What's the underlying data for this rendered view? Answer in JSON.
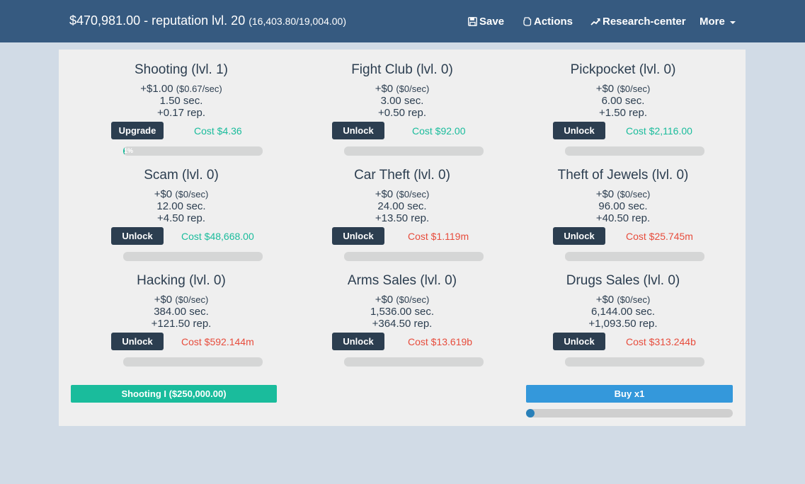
{
  "header": {
    "money": "$470,981.00",
    "reputation": "- reputation lvl. 20",
    "reputation_progress": "(16,403.80/19,004.00)",
    "nav": {
      "save": "Save",
      "actions": "Actions",
      "research": "Research-center",
      "more": "More"
    },
    "icons": {
      "save": "floppy-disk-icon",
      "actions": "hand-icon",
      "research": "trend-up-icon",
      "more": "caret-down-icon"
    }
  },
  "colors": {
    "navbar": "#365a80",
    "affordable": "#1abc9c",
    "unaffordable": "#e74c3c",
    "button": "#2c3e50",
    "buy": "#3498db"
  },
  "activities": [
    {
      "title": "Shooting (lvl. 1)",
      "income": "+$1.00",
      "rate": "($0.67/sec)",
      "time": "1.50 sec.",
      "rep": "+0.17 rep.",
      "button": "Upgrade",
      "cost": "Cost $4.36",
      "affordable": true,
      "progress_pct": 1,
      "progress_label": "1%"
    },
    {
      "title": "Fight Club (lvl. 0)",
      "income": "+$0",
      "rate": "($0/sec)",
      "time": "3.00 sec.",
      "rep": "+0.50 rep.",
      "button": "Unlock",
      "cost": "Cost $92.00",
      "affordable": true,
      "progress_pct": 0,
      "progress_label": ""
    },
    {
      "title": "Pickpocket (lvl. 0)",
      "income": "+$0",
      "rate": "($0/sec)",
      "time": "6.00 sec.",
      "rep": "+1.50 rep.",
      "button": "Unlock",
      "cost": "Cost $2,116.00",
      "affordable": true,
      "progress_pct": 0,
      "progress_label": ""
    },
    {
      "title": "Scam (lvl. 0)",
      "income": "+$0",
      "rate": "($0/sec)",
      "time": "12.00 sec.",
      "rep": "+4.50 rep.",
      "button": "Unlock",
      "cost": "Cost $48,668.00",
      "affordable": true,
      "progress_pct": 0,
      "progress_label": ""
    },
    {
      "title": "Car Theft (lvl. 0)",
      "income": "+$0",
      "rate": "($0/sec)",
      "time": "24.00 sec.",
      "rep": "+13.50 rep.",
      "button": "Unlock",
      "cost": "Cost $1.119m",
      "affordable": false,
      "progress_pct": 0,
      "progress_label": ""
    },
    {
      "title": "Theft of Jewels (lvl. 0)",
      "income": "+$0",
      "rate": "($0/sec)",
      "time": "96.00 sec.",
      "rep": "+40.50 rep.",
      "button": "Unlock",
      "cost": "Cost $25.745m",
      "affordable": false,
      "progress_pct": 0,
      "progress_label": ""
    },
    {
      "title": "Hacking (lvl. 0)",
      "income": "+$0",
      "rate": "($0/sec)",
      "time": "384.00 sec.",
      "rep": "+121.50 rep.",
      "button": "Unlock",
      "cost": "Cost $592.144m",
      "affordable": false,
      "progress_pct": 0,
      "progress_label": ""
    },
    {
      "title": "Arms Sales (lvl. 0)",
      "income": "+$0",
      "rate": "($0/sec)",
      "time": "1,536.00 sec.",
      "rep": "+364.50 rep.",
      "button": "Unlock",
      "cost": "Cost $13.619b",
      "affordable": false,
      "progress_pct": 0,
      "progress_label": ""
    },
    {
      "title": "Drugs Sales (lvl. 0)",
      "income": "+$0",
      "rate": "($0/sec)",
      "time": "6,144.00 sec.",
      "rep": "+1,093.50 rep.",
      "button": "Unlock",
      "cost": "Cost $313.244b",
      "affordable": false,
      "progress_pct": 0,
      "progress_label": ""
    }
  ],
  "footer": {
    "research_button": "Shooting I ($250,000.00)",
    "buy_button": "Buy x1",
    "buy_slider_value": 0
  }
}
